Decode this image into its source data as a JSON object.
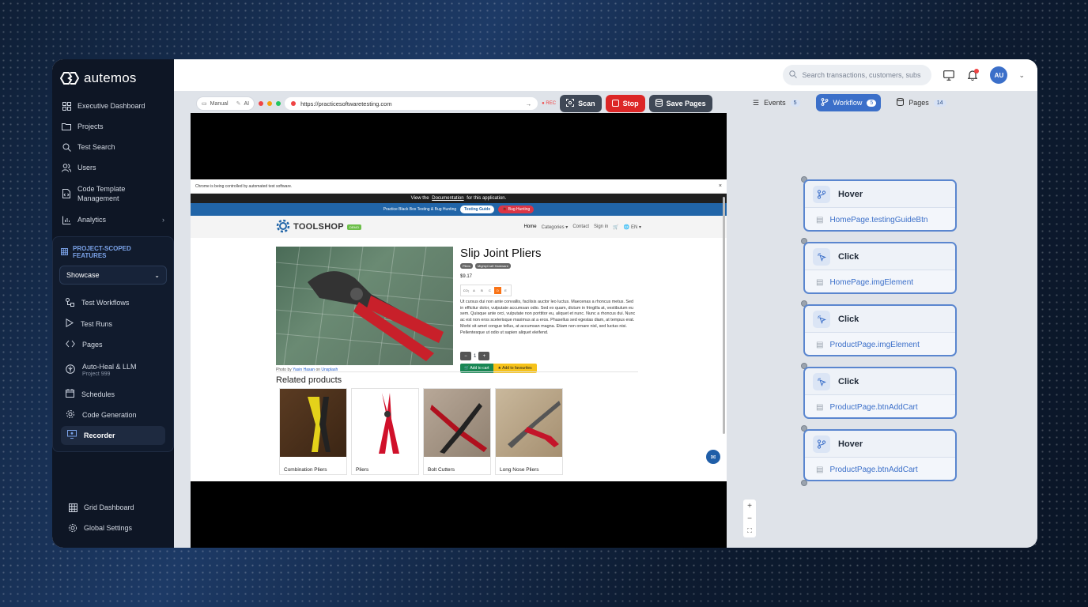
{
  "app": {
    "name": "autemos"
  },
  "sidebar": {
    "items": [
      {
        "label": "Executive Dashboard",
        "icon": "dashboard-icon"
      },
      {
        "label": "Projects",
        "icon": "folder-icon"
      },
      {
        "label": "Test Search",
        "icon": "search-icon"
      },
      {
        "label": "Users",
        "icon": "users-icon"
      },
      {
        "label": "Code Template Management",
        "icon": "file-code-icon"
      },
      {
        "label": "Analytics",
        "icon": "chart-icon"
      }
    ],
    "scoped": {
      "heading": "PROJECT-SCOPED FEATURES",
      "project": "Showcase",
      "items": [
        {
          "label": "Test Workflows"
        },
        {
          "label": "Test Runs"
        },
        {
          "label": "Pages"
        },
        {
          "label": "Auto-Heal & LLM",
          "sub": "Project 999"
        },
        {
          "label": "Schedules"
        },
        {
          "label": "Code Generation"
        },
        {
          "label": "Recorder"
        }
      ]
    },
    "bottom": [
      {
        "label": "Grid Dashboard"
      },
      {
        "label": "Global Settings"
      }
    ]
  },
  "topbar": {
    "search_placeholder": "Search transactions, customers, subs",
    "avatar": "AU"
  },
  "recorder": {
    "mode_manual": "Manual",
    "mode_ai": "AI",
    "url": "https://practicesoftwaretesting.com",
    "rec": "● REC",
    "scan": "Scan",
    "stop": "Stop",
    "save": "Save Pages"
  },
  "browser": {
    "infobar": "Chrome is being controlled by automated test software.",
    "doc_pre": "View the",
    "doc_link": "Documentation",
    "doc_post": "for this application.",
    "practice": "Practice Black Box Testing & Bug Hunting",
    "guide": "Testing Guide",
    "bug": "🐞 Bug Hunting",
    "logo": "TOOLSHOP",
    "logo_tag": "DEMO",
    "menu": {
      "home": "Home",
      "categories": "Categories ▾",
      "contact": "Contact",
      "signin": "Sign in",
      "lang": "🌐 EN ▾"
    },
    "product": {
      "title": "Slip Joint Pliers",
      "tag1": "Pliers",
      "tag2": "MightyCraft Hardware",
      "price": "$9.17",
      "co2": "CO₂",
      "sizes": [
        "A",
        "B",
        "C",
        "D",
        "E"
      ],
      "desc": "Ut cursus dui non ante convallis, facilisis auctor leo luctus. Maecenas a rhoncus metus. Sed in efficitur dolor, vulputate accumsan odio. Sed ex quam, dictum in fringilla at, vestibulum eu sem. Quisque ante orci, vulputate non porttitor eu, aliquet et nunc. Nunc a rhoncus dui. Nunc ac est non eros scelerisque maximus at a eros. Phasellus sed egestas diam, at tempus erat. Morbi sit amet congue tellus, at accumsan magna. Etiam non ornare nisl, sed luctus nisi. Pellentesque ut odio ut sapien aliquet eleifend.",
      "qty": "1",
      "add_cart": "🛒 Add to cart",
      "add_fav": "★ Add to favourites",
      "credit_pre": "Photo by",
      "credit_name": "Yasin Hasan",
      "credit_mid": "on",
      "credit_site": "Unsplash"
    },
    "related_title": "Related products",
    "related": [
      "Combination Pliers",
      "Pliers",
      "Bolt Cutters",
      "Long Nose Pliers"
    ]
  },
  "panel": {
    "tabs": [
      {
        "label": "Events",
        "count": "5"
      },
      {
        "label": "Workflow",
        "count": "5"
      },
      {
        "label": "Pages",
        "count": "14"
      }
    ],
    "nodes": [
      {
        "action": "Hover",
        "target": "HomePage.testingGuideBtn"
      },
      {
        "action": "Click",
        "target": "HomePage.imgElement"
      },
      {
        "action": "Click",
        "target": "ProductPage.imgElement"
      },
      {
        "action": "Click",
        "target": "ProductPage.btnAddCart"
      },
      {
        "action": "Hover",
        "target": "ProductPage.btnAddCart"
      }
    ]
  },
  "colors": {
    "accent": "#3b6fc9",
    "stop": "#dc2626",
    "sidebar": "#0e1625"
  }
}
